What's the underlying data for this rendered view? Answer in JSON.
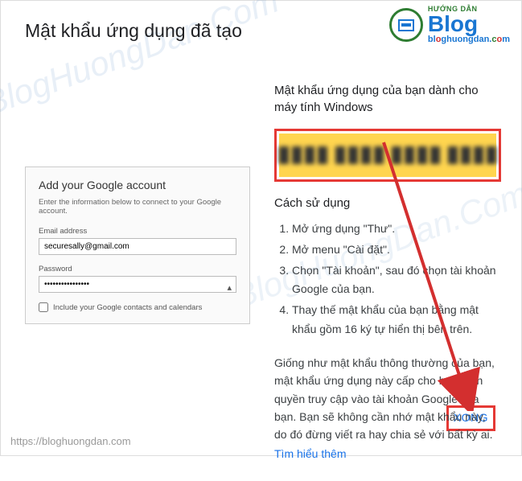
{
  "logo": {
    "small_text": "HƯỚNG DẪN",
    "big_text": "Blog",
    "url_part1": "bl",
    "url_part2": "o",
    "url_part3": "ghuongdan.",
    "url_part4": "c",
    "url_part5": "o",
    "url_part6": "m"
  },
  "page": {
    "title": "Mật khẩu ứng dụng đã tạo"
  },
  "google_panel": {
    "heading": "Add your Google account",
    "subtitle": "Enter the information below to connect to your Google account.",
    "email_label": "Email address",
    "email_value": "securesally@gmail.com",
    "password_label": "Password",
    "password_value": "••••••••••••••••",
    "checkbox_label": "Include your Google contacts and calendars"
  },
  "right": {
    "heading": "Mật khẩu ứng dụng của bạn dành cho máy tính Windows",
    "how_to": "Cách sử dụng",
    "steps": [
      "Mở ứng dụng \"Thư\".",
      "Mở menu \"Cài đặt\".",
      "Chọn \"Tài khoản\", sau đó chọn tài khoản Google của bạn.",
      "Thay thế mật khẩu của bạn bằng mật khẩu gồm 16 ký tự hiển thị bên trên."
    ],
    "info": "Giống như mật khẩu thông thường của bạn, mật khẩu ứng dụng này cấp cho bạn toàn quyền truy cập vào tài khoản Google của bạn. Bạn sẽ không cần nhớ mật khẩu này, do đó đừng viết ra hay chia sẻ với bất kỳ ai.",
    "learn_more": "Tìm hiểu thêm",
    "done": "XONG"
  },
  "footer": {
    "url": "https://bloghuongdan.com"
  }
}
